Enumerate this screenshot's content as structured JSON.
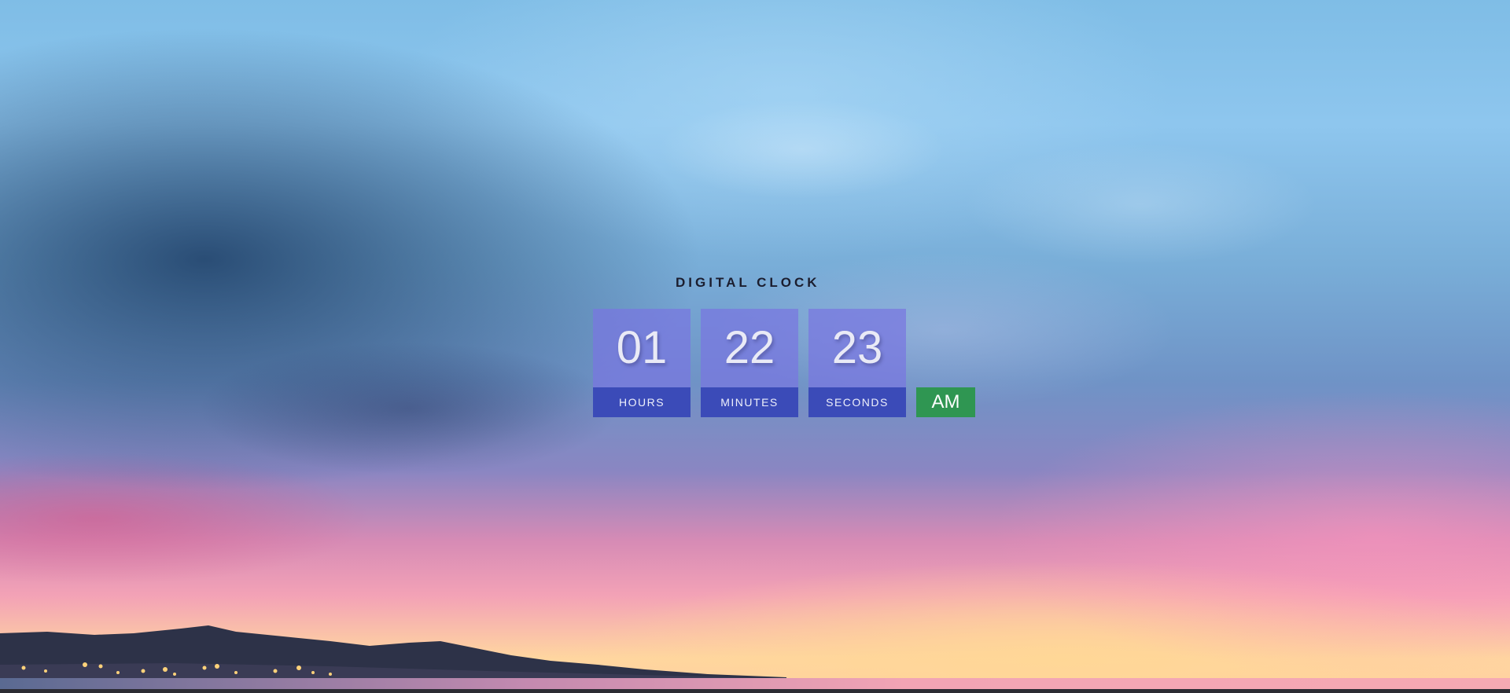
{
  "clock": {
    "title": "DIGITAL CLOCK",
    "units": [
      {
        "value": "01",
        "label": "HOURS"
      },
      {
        "value": "22",
        "label": "MINUTES"
      },
      {
        "value": "23",
        "label": "SECONDS"
      }
    ],
    "period": "AM"
  },
  "colors": {
    "digit_box": "#7876e1",
    "label_bar": "#3b4bb8",
    "period_badge": "#2f9652",
    "title_text": "#1b1d2e"
  }
}
